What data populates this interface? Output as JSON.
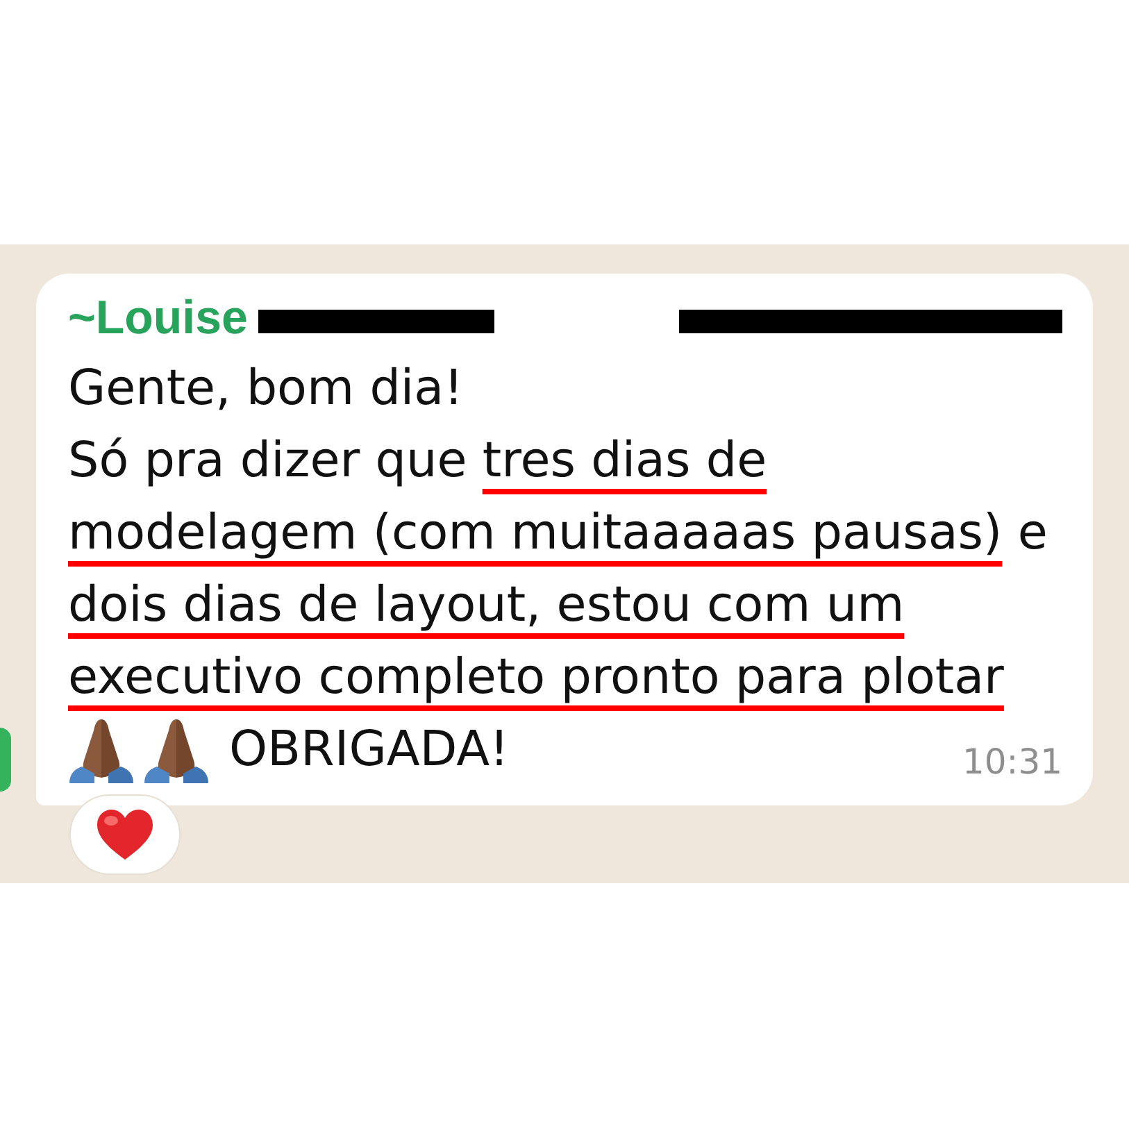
{
  "chat": {
    "message": {
      "author": {
        "name": "~Louise",
        "surname_redacted": true
      },
      "phone_redacted": true,
      "segments": [
        {
          "text": "Gente, bom dia!\nSó pra dizer que ",
          "underlined": false
        },
        {
          "text": "tres dias de modelagem (com muitaaaaas pausas)",
          "underlined": true
        },
        {
          "text": " e ",
          "underlined": false
        },
        {
          "text": "dois dias de layout, estou com um executivo completo pronto para plotar",
          "underlined": true
        }
      ],
      "closing": {
        "emoji": [
          {
            "kind": "pray"
          },
          {
            "kind": "pray"
          }
        ],
        "text": "OBRIGADA!"
      },
      "time": "10:31",
      "reactions": [
        {
          "kind": "heart"
        }
      ]
    }
  }
}
